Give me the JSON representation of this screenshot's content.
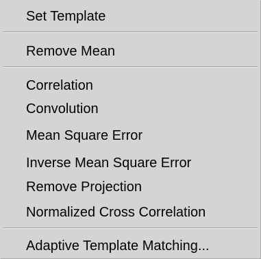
{
  "menu": {
    "set_template": "Set Template",
    "remove_mean": "Remove Mean",
    "correlation": "Correlation",
    "convolution": "Convolution",
    "mean_square_error": "Mean Square Error",
    "inverse_mean_square_error": "Inverse Mean Square Error",
    "remove_projection": "Remove Projection",
    "normalized_cross_correlation": "Normalized Cross Correlation",
    "adaptive_template_matching": "Adaptive Template Matching..."
  },
  "colors": {
    "menu_background": "#d4d4d4",
    "separator_dark": "#9e9e9e",
    "separator_light": "#f2f2f2",
    "text": "#000000"
  }
}
